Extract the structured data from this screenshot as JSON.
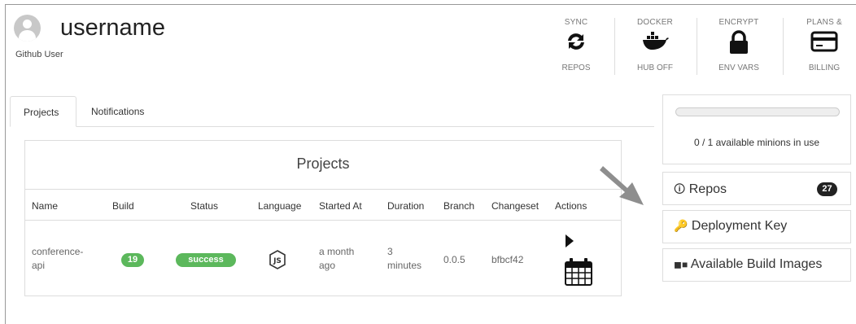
{
  "user": {
    "name": "username",
    "subtitle": "Github User"
  },
  "header_buttons": [
    {
      "top": "SYNC",
      "bottom": "REPOS",
      "icon": "sync-icon"
    },
    {
      "top": "DOCKER",
      "bottom": "HUB OFF",
      "icon": "docker-icon"
    },
    {
      "top": "ENCRYPT",
      "bottom": "ENV VARS",
      "icon": "lock-icon"
    },
    {
      "top": "PLANS &",
      "bottom": "BILLING",
      "icon": "credit-card-icon"
    }
  ],
  "tabs": [
    {
      "label": "Projects",
      "active": true
    },
    {
      "label": "Notifications",
      "active": false
    }
  ],
  "projects": {
    "title": "Projects",
    "columns": [
      "Name",
      "Build",
      "Status",
      "Language",
      "Started At",
      "Duration",
      "Branch",
      "Changeset",
      "Actions"
    ],
    "rows": [
      {
        "name_line1": "conference-",
        "name_line2": "api",
        "build": "19",
        "status": "success",
        "language_icon": "nodejs-icon",
        "started_line1": "a month",
        "started_line2": "ago",
        "duration_line1": "3",
        "duration_line2": "minutes",
        "branch": "0.0.5",
        "changeset": "bfbcf42",
        "actions": [
          "play-icon",
          "calendar-icon"
        ]
      }
    ]
  },
  "sidebar": {
    "minions": {
      "text": "0 / 1 available minions in use",
      "used": 0,
      "total": 1
    },
    "links": [
      {
        "label": "Repos",
        "icon": "book-icon",
        "badge": "27"
      },
      {
        "label": "Deployment Key",
        "icon": "key-icon"
      },
      {
        "label": "Available Build Images",
        "icon": "build-images-icon"
      }
    ]
  },
  "colors": {
    "success": "#5cb85c",
    "badge": "#222222",
    "header_text": "#777777"
  }
}
